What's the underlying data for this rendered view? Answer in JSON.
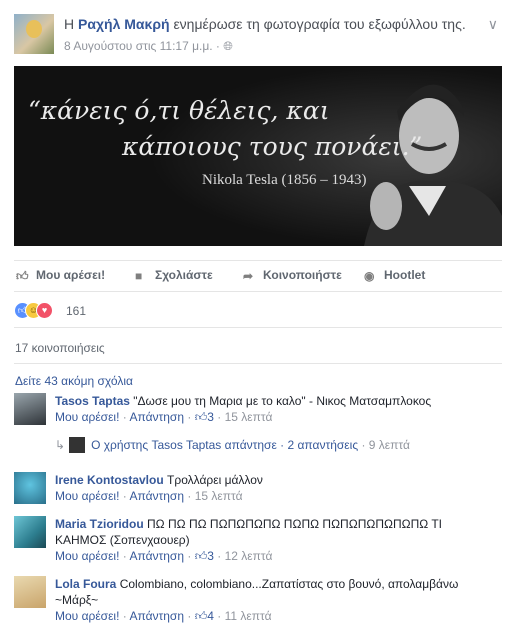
{
  "post": {
    "prefix": "Η",
    "author": "Ραχήλ Μακρή",
    "action": "ενημέρωσε τη φωτογραφία του εξωφύλλου της.",
    "timestamp": "8 Αυγούστου στις 11:17 μ.μ. ·",
    "privacy_icon": "globe-icon",
    "menu_icon": "chevron-down-icon"
  },
  "cover": {
    "quote_line1": "“κάνεις ό,τι θέλεις, και",
    "quote_line2": "κάποιους τους πονάει.”",
    "attribution": "Nikola Tesla (1856 – 1943)"
  },
  "actions": {
    "like": "Μου αρέσει!",
    "comment": "Σχολιάστε",
    "share": "Κοινοποιήστε",
    "hootlet": "Hootlet"
  },
  "reactions": {
    "count": "161",
    "types": [
      "like",
      "haha",
      "love"
    ]
  },
  "shares_text": "17 κοινοποιήσεις",
  "more_comments": "Δείτε 43 ακόμη σχόλια",
  "comments": [
    {
      "name": "Tasos Taptas",
      "text": "\"Δωσε μου τη Μαρια με το καλο\" - Νικος Ματσαμπλοκος",
      "like": "Μου αρέσει!",
      "reply": "Απάντηση",
      "likes": "3",
      "time": "15 λεπτά",
      "dot": "·"
    },
    {
      "name": "Irene Kontostavlou",
      "text": "Τρολλάρει μάλλον",
      "like": "Μου αρέσει!",
      "reply": "Απάντηση",
      "likes": "",
      "time": "15 λεπτά",
      "dot": "·"
    },
    {
      "name": "Maria Tzioridou",
      "text": "ΠΩ ΠΩ ΠΩ ΠΩΠΩΠΩΠΩ ΠΩΠΩ ΠΩΠΩΠΩΠΩΠΩΠΩ ΤΙ ΚΑΗΜΟΣ (Σοπενχαουερ)",
      "like": "Μου αρέσει!",
      "reply": "Απάντηση",
      "likes": "3",
      "time": "12 λεπτά",
      "dot": "·"
    },
    {
      "name": "Lola Foura",
      "text": "Colombiano, colombiano...Ζαπατίστας στο βουνό, απολαμβάνω ~Μάρξ~",
      "like": "Μου αρέσει!",
      "reply": "Απάντηση",
      "likes": "4",
      "time": "11 λεπτά",
      "dot": "·"
    }
  ],
  "reply_summary": {
    "user_prefix": "Ο χρήστης",
    "user": "Tasos Taptas",
    "replied": "απάντησε ·",
    "count": "2 απαντήσεις",
    "time": "· 9 λεπτά"
  }
}
